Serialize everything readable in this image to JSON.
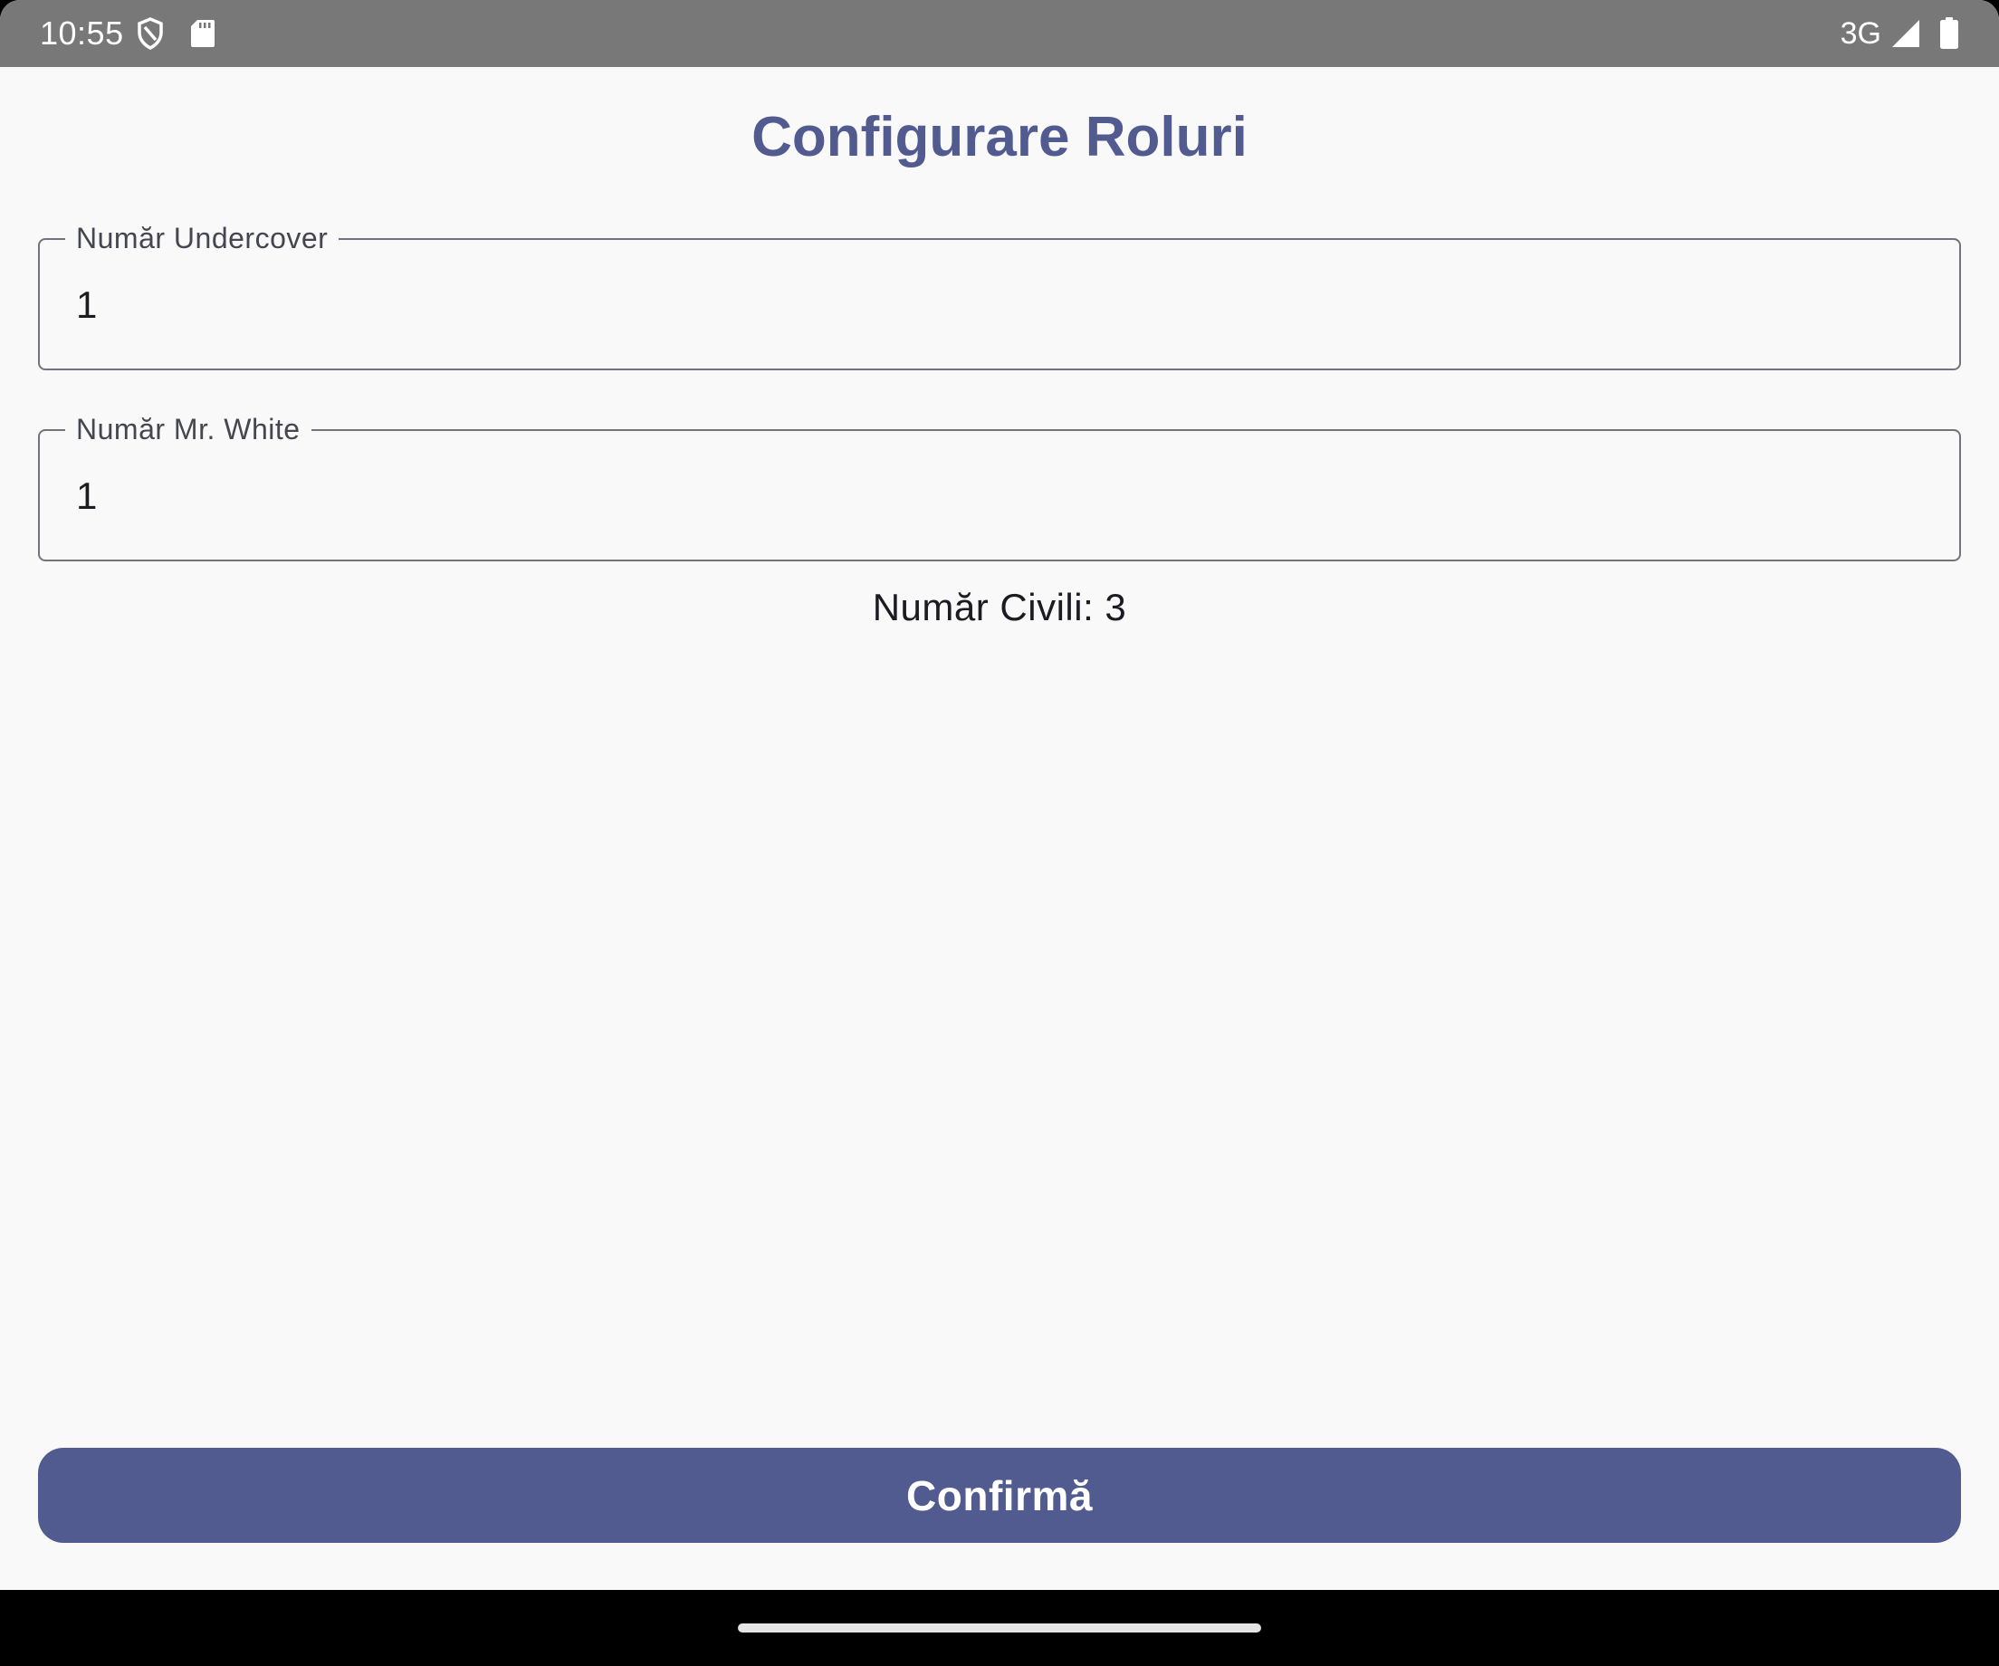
{
  "status_bar": {
    "time": "10:55",
    "network": "3G",
    "icons": [
      "shield-icon",
      "sd-card-icon",
      "signal-icon",
      "battery-icon"
    ]
  },
  "title": "Configurare Roluri",
  "fields": {
    "undercover": {
      "label": "Număr Undercover",
      "value": "1"
    },
    "mr_white": {
      "label": "Număr Mr. White",
      "value": "1"
    }
  },
  "civili_text": "Număr Civili: 3",
  "confirm_label": "Confirmă",
  "colors": {
    "accent": "#515b90",
    "background": "#f9f9f9",
    "status_bar": "#787878",
    "outline": "#73737d"
  }
}
